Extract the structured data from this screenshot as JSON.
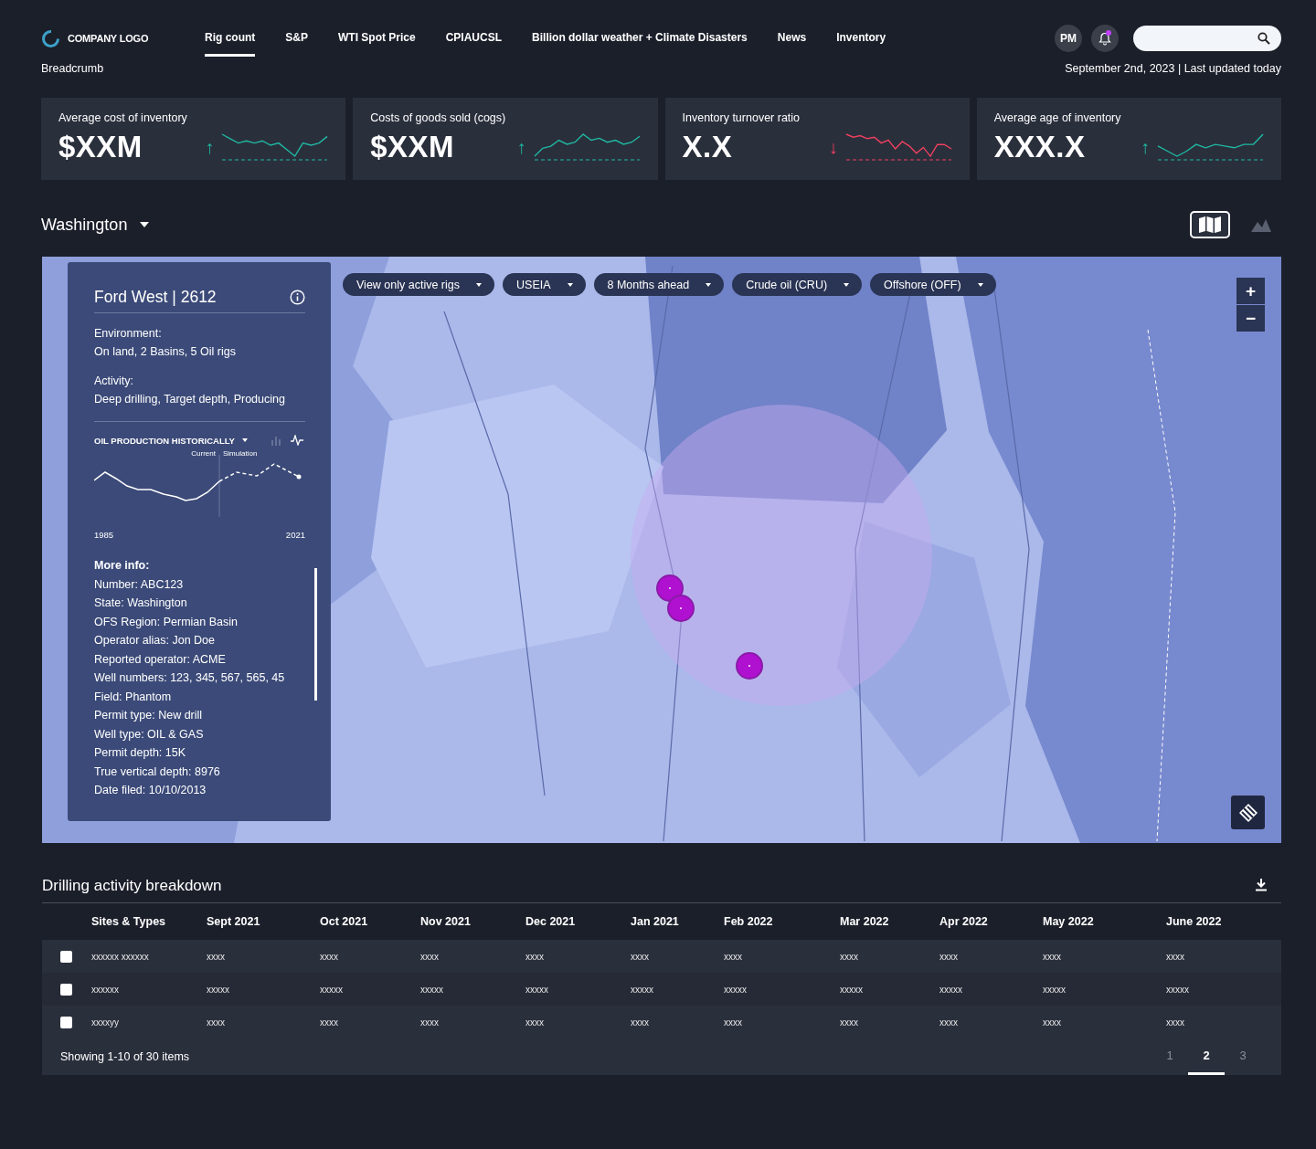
{
  "header": {
    "logo": "COMPANY LOGO",
    "nav": [
      {
        "label": "Rig count",
        "selected": true
      },
      {
        "label": "S&P",
        "selected": false
      },
      {
        "label": "WTI Spot Price",
        "selected": false
      },
      {
        "label": "CPIAUCSL",
        "selected": false
      },
      {
        "label": "Billion dollar weather + Climate Disasters",
        "selected": false
      },
      {
        "label": "News",
        "selected": false
      },
      {
        "label": "Inventory",
        "selected": false
      }
    ],
    "avatar": "PM",
    "notifications_unread": true
  },
  "breadcrumb": "Breadcrumb",
  "updated": "September 2nd, 2023 | Last updated today",
  "kpis": [
    {
      "title": "Average cost of inventory",
      "value": "$XXM",
      "arrow": "↑",
      "kind": "up"
    },
    {
      "title": "Costs of goods sold (cogs)",
      "value": "$XXM",
      "arrow": "↑",
      "kind": "up"
    },
    {
      "title": "Inventory turnover ratio",
      "value": "X.X",
      "arrow": "↓",
      "kind": "down"
    },
    {
      "title": "Average age of inventory",
      "value": "XXX.X",
      "arrow": "↑",
      "kind": "up"
    }
  ],
  "region": "Washington",
  "views": [
    {
      "kind": "map",
      "selected": true
    },
    {
      "kind": "chart",
      "selected": false
    }
  ],
  "map": {
    "filters": [
      "View only active rigs",
      "USEIA",
      "8 Months ahead",
      "Crude oil (CRU)",
      "Offshore (OFF)"
    ],
    "zoom": [
      "+",
      "−"
    ],
    "info_panel": {
      "title": "Ford West | 2612",
      "sections": [
        {
          "label": "Environment:",
          "value": "On land, 2 Basins, 5 Oil rigs"
        },
        {
          "label": "Activity:",
          "value": "Deep drilling, Target depth, Producing"
        }
      ],
      "chart": {
        "title": "OIL PRODUCTION HISTORICALLY",
        "current_label": "Current",
        "simulation_label": "Simulation",
        "start": "1985",
        "end": "2021",
        "views": [
          {
            "kind": "bar",
            "selected": false
          },
          {
            "kind": "line",
            "selected": true
          }
        ]
      },
      "more_title": "More info:",
      "more": [
        "Number: ABC123",
        "State: Washington",
        "OFS Region: Permian Basin",
        "Operator alias: Jon Doe",
        "Reported operator: ACME",
        "Well numbers: 123, 345, 567, 565, 45",
        "Field: Phantom",
        "Permit type: New drill",
        "Well type: OIL & GAS",
        "Permit depth: 15K",
        "True vertical depth: 8976",
        "Date filed: 10/10/2013"
      ]
    }
  },
  "table": {
    "title": "Drilling activity breakdown",
    "columns": [
      "Sites & Types",
      "Sept 2021",
      "Oct 2021",
      "Nov 2021",
      "Dec 2021",
      "Jan 2021",
      "Feb 2022",
      "Mar 2022",
      "Apr 2022",
      "May 2022",
      "June 2022"
    ],
    "rows": [
      {
        "checked": false,
        "cells": [
          "xxxxxx xxxxxx",
          "xxxx",
          "xxxx",
          "xxxx",
          "xxxx",
          "xxxx",
          "xxxx",
          "xxxx",
          "xxxx",
          "xxxx",
          "xxxx"
        ]
      },
      {
        "checked": false,
        "cells": [
          "xxxxxx",
          "xxxxx",
          "xxxxx",
          "xxxxx",
          "xxxxx",
          "xxxxx",
          "xxxxx",
          "xxxxx",
          "xxxxx",
          "xxxxx",
          "xxxxx"
        ]
      },
      {
        "checked": false,
        "cells": [
          "xxxxyy",
          "xxxx",
          "xxxx",
          "xxxx",
          "xxxx",
          "xxxx",
          "xxxx",
          "xxxx",
          "xxxx",
          "xxxx",
          "xxxx"
        ]
      }
    ],
    "footer": "Showing 1-10 of 30 items",
    "pages": [
      {
        "label": "1",
        "selected": false
      },
      {
        "label": "2",
        "selected": true
      },
      {
        "label": "3",
        "selected": false
      }
    ]
  }
}
